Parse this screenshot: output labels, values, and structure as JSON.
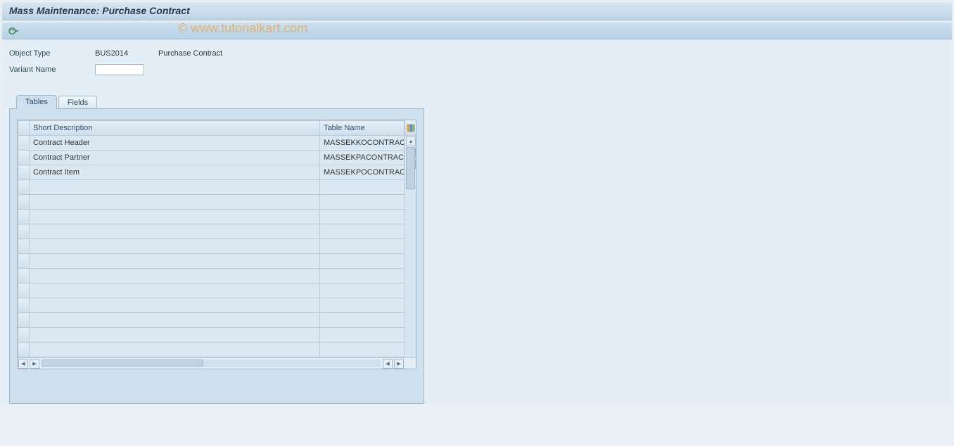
{
  "title": "Mass Maintenance: Purchase Contract",
  "watermark": "© www.tutorialkart.com",
  "form": {
    "object_type_label": "Object Type",
    "object_type_value": "BUS2014",
    "object_type_desc": "Purchase Contract",
    "variant_name_label": "Variant Name",
    "variant_name_value": ""
  },
  "tabs": {
    "tables": "Tables",
    "fields": "Fields"
  },
  "grid": {
    "columns": {
      "short_description": "Short Description",
      "table_name": "Table Name"
    },
    "rows": [
      {
        "desc": "Contract Header",
        "table": "MASSEKKOCONTRACT"
      },
      {
        "desc": "Contract Partner",
        "table": "MASSEKPACONTRACT"
      },
      {
        "desc": "Contract Item",
        "table": "MASSEKPOCONTRACT"
      },
      {
        "desc": "",
        "table": ""
      },
      {
        "desc": "",
        "table": ""
      },
      {
        "desc": "",
        "table": ""
      },
      {
        "desc": "",
        "table": ""
      },
      {
        "desc": "",
        "table": ""
      },
      {
        "desc": "",
        "table": ""
      },
      {
        "desc": "",
        "table": ""
      },
      {
        "desc": "",
        "table": ""
      },
      {
        "desc": "",
        "table": ""
      },
      {
        "desc": "",
        "table": ""
      },
      {
        "desc": "",
        "table": ""
      },
      {
        "desc": "",
        "table": ""
      }
    ]
  }
}
